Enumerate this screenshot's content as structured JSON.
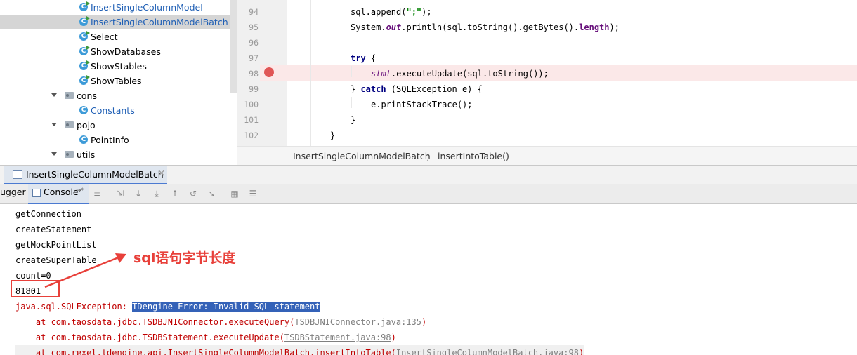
{
  "tree": {
    "items": [
      {
        "label": "InsertSingleColumnModel",
        "type": "class",
        "runnable": true,
        "color": "blue",
        "selected": false
      },
      {
        "label": "InsertSingleColumnModelBatch",
        "type": "class",
        "runnable": true,
        "color": "blue",
        "selected": true
      },
      {
        "label": "Select",
        "type": "class",
        "runnable": true,
        "color": "dark",
        "selected": false
      },
      {
        "label": "ShowDatabases",
        "type": "class",
        "runnable": true,
        "color": "dark",
        "selected": false
      },
      {
        "label": "ShowStables",
        "type": "class",
        "runnable": true,
        "color": "dark",
        "selected": false
      },
      {
        "label": "ShowTables",
        "type": "class",
        "runnable": true,
        "color": "dark",
        "selected": false
      },
      {
        "label": "cons",
        "type": "package"
      },
      {
        "label": "Constants",
        "type": "class",
        "runnable": false,
        "color": "blue",
        "selected": false
      },
      {
        "label": "pojo",
        "type": "package"
      },
      {
        "label": "PointInfo",
        "type": "class",
        "runnable": false,
        "color": "dark",
        "selected": false
      },
      {
        "label": "utils",
        "type": "package"
      }
    ],
    "class_icon_letter": "C"
  },
  "editor": {
    "line_numbers": [
      "94",
      "95",
      "96",
      "97",
      "98",
      "99",
      "100",
      "101",
      "102"
    ],
    "code": {
      "l94_a": "sql.append(",
      "l94_b": "\";\"",
      "l94_c": ");",
      "l95_a": "System.",
      "l95_b": "out",
      "l95_c": ".println(sql.toString().getBytes().",
      "l95_d": "length",
      "l95_e": ");",
      "l97_a": "try",
      "l97_b": " {",
      "l98_a": "stmt",
      "l98_b": ".executeUpdate(sql.toString());",
      "l99_a": "} ",
      "l99_b": "catch",
      "l99_c": " (SQLException e) {",
      "l100": "e.printStackTrace();",
      "l101": "}",
      "l102": "}"
    },
    "breadcrumb": [
      "InsertSingleColumnModelBatch",
      "insertIntoTable()"
    ],
    "breadcrumb_sep": "〉"
  },
  "run_panel": {
    "tab_label": "InsertSingleColumnModelBatch",
    "close_glyph": "×",
    "debugger_tab": "ugger",
    "console_tab": "Console",
    "console_tab_suffix": "→*"
  },
  "console": {
    "lines": [
      "getConnection",
      "createStatement",
      "getMockPointList",
      "createSuperTable",
      "count=0",
      "81801"
    ],
    "exception_prefix": "java.sql.SQLException: ",
    "exception_selected": "TDengine Error: Invalid SQL statement",
    "stack": [
      {
        "prefix": "    at com.taosdata.jdbc.TSDBJNIConnector.executeQuery(",
        "link": "TSDBJNIConnector.java:135",
        "suffix": ")"
      },
      {
        "prefix": "    at com.taosdata.jdbc.TSDBStatement.executeUpdate(",
        "link": "TSDBStatement.java:98",
        "suffix": ")"
      },
      {
        "prefix": "    at com.rexel.tdengine.api.InsertSingleColumnModelBatch.insertIntoTable(",
        "link": "InsertSingleColumnModelBatch.java:98",
        "suffix": ")"
      }
    ]
  },
  "annotation": {
    "text": "sql语句字节长度",
    "color": "#e8403a"
  }
}
